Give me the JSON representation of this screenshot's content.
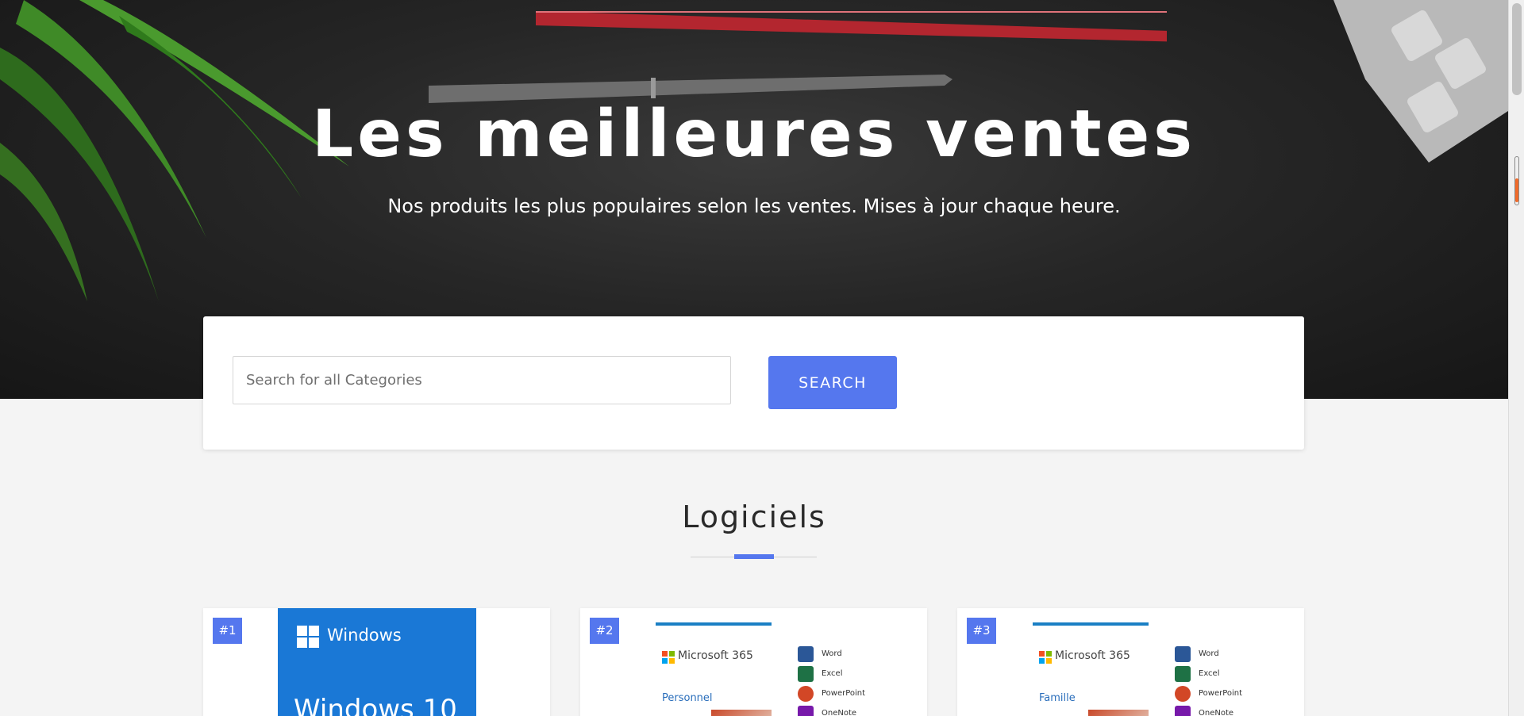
{
  "hero": {
    "title": "Les meilleures ventes",
    "subtitle": "Nos produits les plus populaires selon les ventes. Mises à jour chaque heure."
  },
  "search": {
    "placeholder": "Search for all Categories",
    "button_label": "SEARCH"
  },
  "section": {
    "title": "Logiciels"
  },
  "products": [
    {
      "rank": "#1",
      "brand": "Windows",
      "name": "Windows 10"
    },
    {
      "rank": "#2",
      "brand": "Microsoft 365",
      "edition": "Personnel",
      "apps": [
        "Word",
        "Excel",
        "PowerPoint",
        "OneNote"
      ]
    },
    {
      "rank": "#3",
      "brand": "Microsoft 365",
      "edition": "Famille",
      "apps": [
        "Word",
        "Excel",
        "PowerPoint",
        "OneNote"
      ]
    }
  ],
  "colors": {
    "accent": "#5577ee",
    "windows_blue": "#1a78d6",
    "word": "#2b5797",
    "excel": "#1e7145",
    "powerpoint": "#d24726",
    "onenote": "#7719aa"
  },
  "icons": [
    "windows-logo-icon",
    "microsoft-logo-icon",
    "word-icon",
    "excel-icon",
    "powerpoint-icon",
    "onenote-icon"
  ]
}
